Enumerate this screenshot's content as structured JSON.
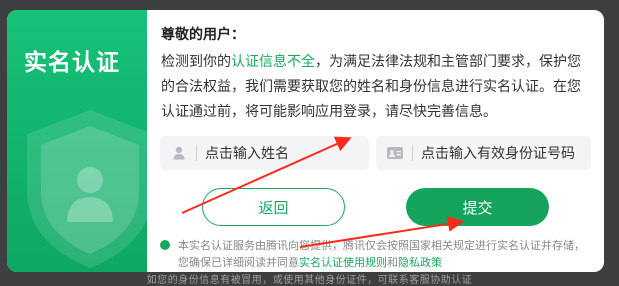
{
  "background_hint": "如您的身份信息有被冒用，或使用其他身份证件，可联系客服协助认证",
  "left_panel": {
    "title": "实名认证",
    "icon": "shield-user-icon",
    "color": "#13b86e"
  },
  "greeting": "尊敬的用户：",
  "notice": {
    "before": "检测到你的",
    "highlight": "认证信息不全",
    "after": "，为满足法律法规和主管部门要求，保护您的合法权益，我们需要获取您的姓名和身份信息进行实名认证。在您认证通过前，将可能影响应用登录，请尽快完善信息。"
  },
  "fields": {
    "name_placeholder": "点击输入姓名",
    "name_icon": "user-icon",
    "id_placeholder": "点击输入有效身份证号码",
    "id_icon": "id-card-icon"
  },
  "buttons": {
    "back": "返回",
    "submit": "提交"
  },
  "agreement": {
    "text": "本实名认证服务由腾讯向您提供，腾讯仅会按照国家相关规定进行实名认证并存储，您确保已详细阅读并同意",
    "link1": "实名认证使用规则",
    "and": "和",
    "link2": "隐私政策"
  },
  "colors": {
    "accent": "#1aa861",
    "annotation_arrow": "#ff2a1a"
  }
}
